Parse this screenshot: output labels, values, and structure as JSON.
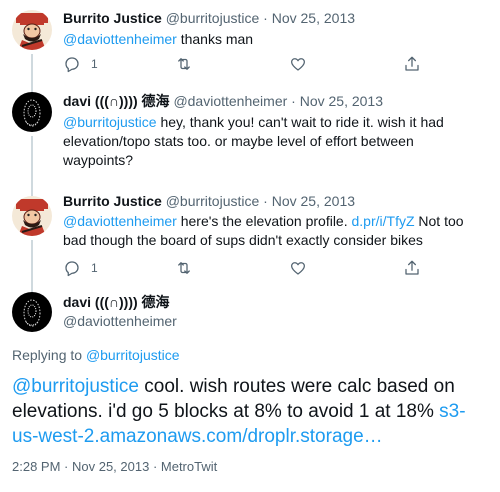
{
  "tweets": [
    {
      "name": "Burrito Justice",
      "handle": "@burritojustice",
      "date": "Nov 25, 2013",
      "mention": "@daviottenheimer",
      "text": " thanks man",
      "reply_count": "1",
      "avatar": "burrito-justice-avatar"
    },
    {
      "name": "davi (((∩)))) 德海",
      "handle": "@daviottenheimer",
      "date": "Nov 25, 2013",
      "mention": "@burritojustice",
      "text": " hey, thank you! can't wait to ride it. wish it had elevation/topo stats too. or maybe level of effort between waypoints?",
      "avatar": "davi-avatar"
    },
    {
      "name": "Burrito Justice",
      "handle": "@burritojustice",
      "date": "Nov 25, 2013",
      "mention": "@daviottenheimer",
      "text_a": " here's the elevation profile. ",
      "link": "d.pr/i/TfyZ",
      "text_b": " Not too bad though the board of sups didn't exactly consider bikes",
      "reply_count": "1",
      "avatar": "burrito-justice-avatar"
    }
  ],
  "main": {
    "name": "davi (((∩)))) 德海",
    "handle": "@daviottenheimer",
    "replying_prefix": "Replying to ",
    "replying_to": "@burritojustice",
    "mention": "@burritojustice",
    "text": " cool. wish routes were calc based on elevations. i'd go 5 blocks at 8% to avoid 1 at 18% ",
    "link": "s3-us-west-2.amazonaws.com/droplr.storage…",
    "time": "2:28 PM",
    "date": "Nov 25, 2013",
    "client": "MetroTwit",
    "separator": " · "
  },
  "dot": "·",
  "colors": {
    "accent": "#1d9bf0",
    "secondary_text": "#536471",
    "thread_line": "#cfd9de"
  }
}
